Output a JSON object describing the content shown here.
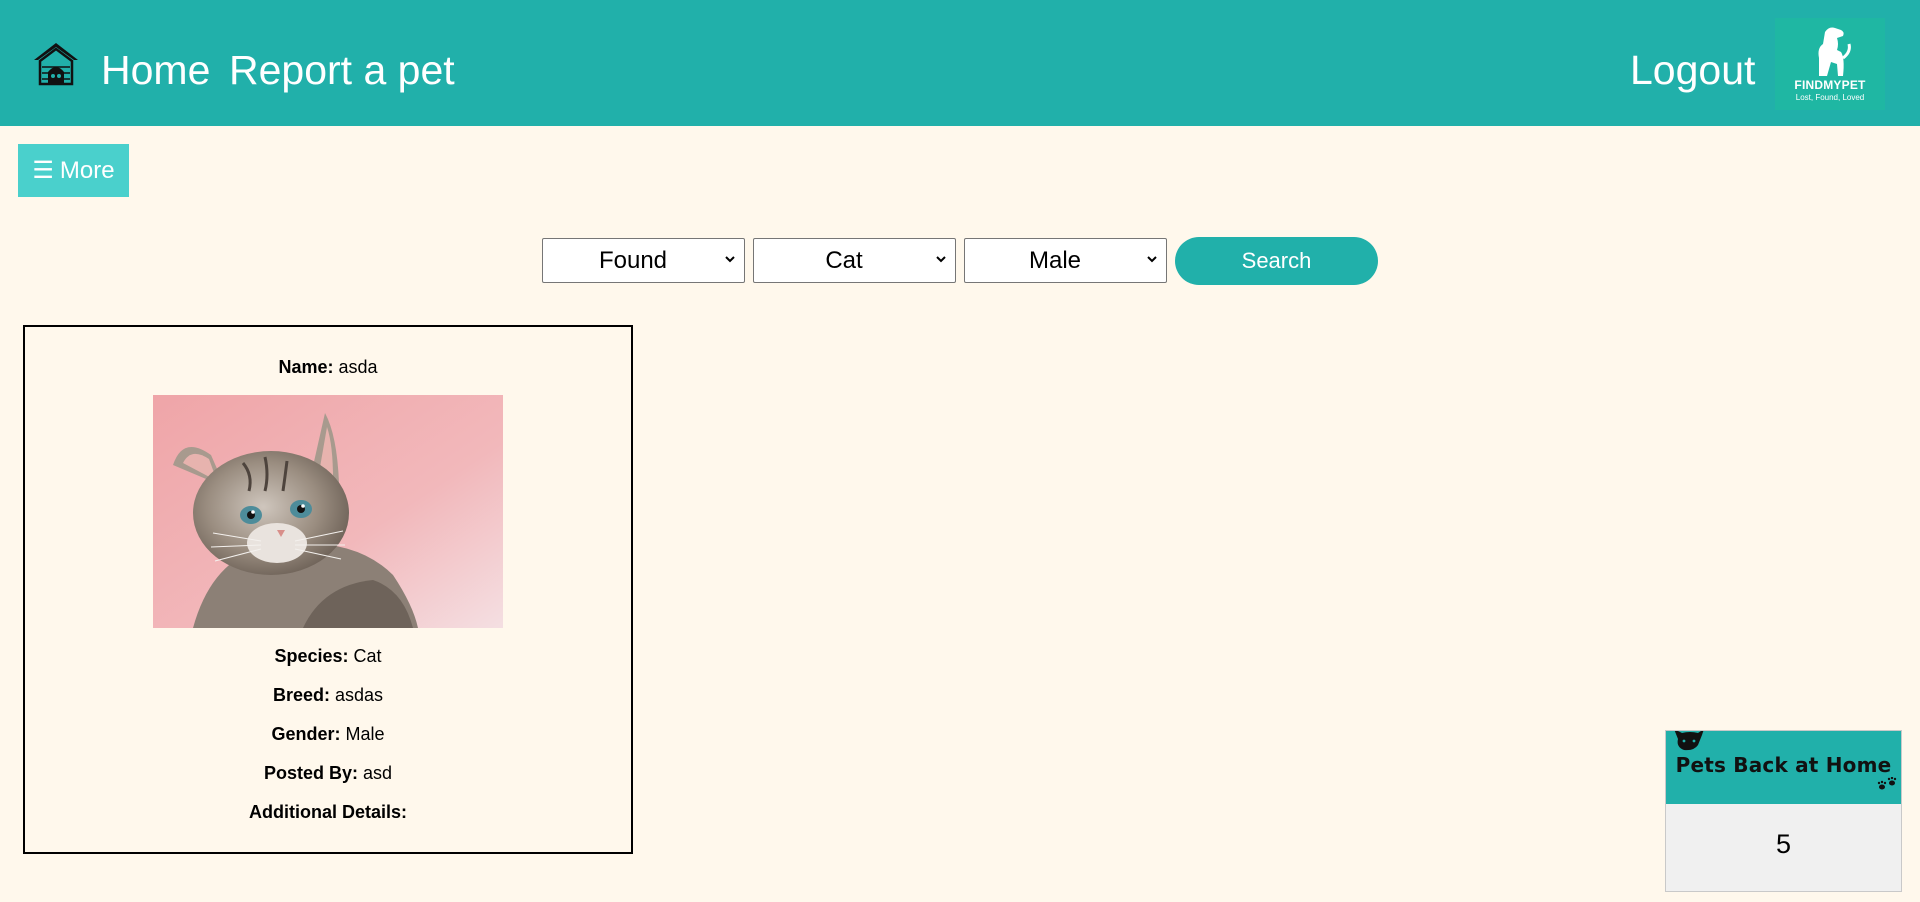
{
  "header": {
    "nav": {
      "home_label": "Home",
      "report_label": "Report a pet",
      "logout_label": "Logout"
    },
    "logo": {
      "title": "FINDMYPET",
      "tagline": "Lost, Found, Loved"
    }
  },
  "more_button": {
    "icon": "menu-icon",
    "label": "More"
  },
  "filters": {
    "status": {
      "selected": "Found"
    },
    "species": {
      "selected": "Cat"
    },
    "gender": {
      "selected": "Male"
    },
    "search_label": "Search"
  },
  "pet_card": {
    "name": {
      "label": "Name:",
      "value": "asda"
    },
    "species": {
      "label": "Species:",
      "value": "Cat"
    },
    "breed": {
      "label": "Breed:",
      "value": "asdas"
    },
    "gender": {
      "label": "Gender:",
      "value": "Male"
    },
    "posted_by": {
      "label": "Posted By:",
      "value": "asd"
    },
    "additional_details": {
      "label": "Additional Details:",
      "value": ""
    }
  },
  "stats_widget": {
    "title": "Pets Back at Home",
    "count": "5"
  },
  "colors": {
    "header_bg": "#21b0aa",
    "more_button_bg": "#4ad0cc",
    "page_bg": "#fff8ec",
    "logo_bg": "#1fb7a3"
  }
}
